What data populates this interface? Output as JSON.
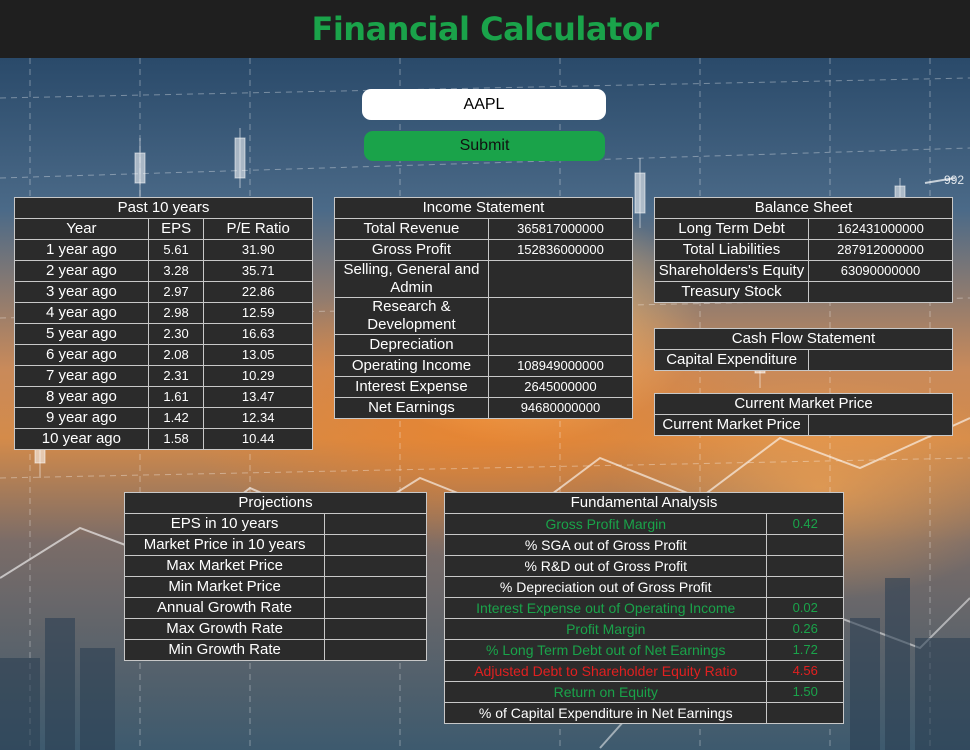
{
  "app": {
    "title": "Financial Calculator"
  },
  "ticker": {
    "value": "AAPL"
  },
  "submit_label": "Submit",
  "past": {
    "title": "Past 10 years",
    "headers": [
      "Year",
      "EPS",
      "P/E Ratio"
    ],
    "rows": [
      [
        "1 year ago",
        "5.61",
        "31.90"
      ],
      [
        "2 year ago",
        "3.28",
        "35.71"
      ],
      [
        "3 year ago",
        "2.97",
        "22.86"
      ],
      [
        "4 year ago",
        "2.98",
        "12.59"
      ],
      [
        "5 year ago",
        "2.30",
        "16.63"
      ],
      [
        "6 year ago",
        "2.08",
        "13.05"
      ],
      [
        "7 year ago",
        "2.31",
        "10.29"
      ],
      [
        "8 year ago",
        "1.61",
        "13.47"
      ],
      [
        "9 year ago",
        "1.42",
        "12.34"
      ],
      [
        "10 year ago",
        "1.58",
        "10.44"
      ]
    ]
  },
  "income": {
    "title": "Income Statement",
    "rows": [
      [
        "Total Revenue",
        "365817000000"
      ],
      [
        "Gross Profit",
        "152836000000"
      ],
      [
        "Selling, General and Admin",
        ""
      ],
      [
        "Research & Development",
        ""
      ],
      [
        "Depreciation",
        ""
      ],
      [
        "Operating Income",
        "108949000000"
      ],
      [
        "Interest Expense",
        "2645000000"
      ],
      [
        "Net Earnings",
        "94680000000"
      ]
    ]
  },
  "balance": {
    "title": "Balance Sheet",
    "rows": [
      [
        "Long Term Debt",
        "162431000000"
      ],
      [
        "Total Liabilities",
        "287912000000"
      ],
      [
        "Shareholders's Equity",
        "63090000000"
      ],
      [
        "Treasury Stock",
        ""
      ]
    ]
  },
  "cashflow": {
    "title": "Cash Flow Statement",
    "rows": [
      [
        "Capital Expenditure",
        ""
      ]
    ]
  },
  "market": {
    "title": "Current Market Price",
    "rows": [
      [
        "Current Market Price",
        ""
      ]
    ]
  },
  "projections": {
    "title": "Projections",
    "rows": [
      [
        "EPS in 10 years",
        ""
      ],
      [
        "Market Price in 10 years",
        ""
      ],
      [
        "Max Market Price",
        ""
      ],
      [
        "Min Market Price",
        ""
      ],
      [
        "Annual Growth Rate",
        ""
      ],
      [
        "Max Growth Rate",
        ""
      ],
      [
        "Min Growth Rate",
        ""
      ]
    ]
  },
  "fundamental": {
    "title": "Fundamental Analysis",
    "rows": [
      [
        "Gross Profit Margin",
        "0.42",
        "green"
      ],
      [
        "% SGA out of Gross Profit",
        "",
        "white"
      ],
      [
        "% R&D out of Gross Profit",
        "",
        "white"
      ],
      [
        "% Depreciation out of Gross Profit",
        "",
        "white"
      ],
      [
        "Interest Expense out of Operating Income",
        "0.02",
        "green"
      ],
      [
        "Profit Margin",
        "0.26",
        "green"
      ],
      [
        "% Long Term Debt out of Net Earnings",
        "1.72",
        "green"
      ],
      [
        "Adjusted Debt to Shareholder Equity Ratio",
        "4.56",
        "red"
      ],
      [
        "Return on Equity",
        "1.50",
        "green"
      ],
      [
        "% of Capital Expenditure in Net Earnings",
        "",
        "white"
      ]
    ]
  },
  "colors": {
    "accent_green": "#1aa34a",
    "alert_red": "#e02020",
    "panel_bg": "#2b2b2b"
  },
  "background": {
    "corner_label": "992"
  }
}
